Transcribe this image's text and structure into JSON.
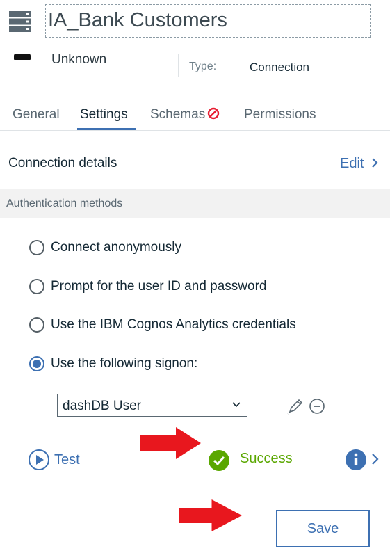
{
  "header": {
    "title": "IA_Bank Customers",
    "owner": "Unknown",
    "type_label": "Type:",
    "type_value": "Connection"
  },
  "tabs": [
    {
      "label": "General",
      "active": false
    },
    {
      "label": "Settings",
      "active": true
    },
    {
      "label": "Schemas",
      "active": false,
      "icon": "no-entry-icon"
    },
    {
      "label": "Permissions",
      "active": false
    }
  ],
  "connection_details": {
    "title": "Connection details",
    "edit_label": "Edit"
  },
  "auth": {
    "section_title": "Authentication methods",
    "options": [
      {
        "label": "Connect anonymously",
        "checked": false
      },
      {
        "label": "Prompt for the user ID and password",
        "checked": false
      },
      {
        "label": "Use the IBM Cognos Analytics credentials",
        "checked": false
      },
      {
        "label": "Use the following signon:",
        "checked": true
      }
    ],
    "signon_selected": "dashDB User"
  },
  "test": {
    "test_label": "Test",
    "status_text": "Success"
  },
  "footer": {
    "save_label": "Save"
  },
  "colors": {
    "accent": "#3d70b2",
    "success": "#5aa700",
    "error": "#e71d32",
    "annotation_arrow": "#e8171e"
  }
}
